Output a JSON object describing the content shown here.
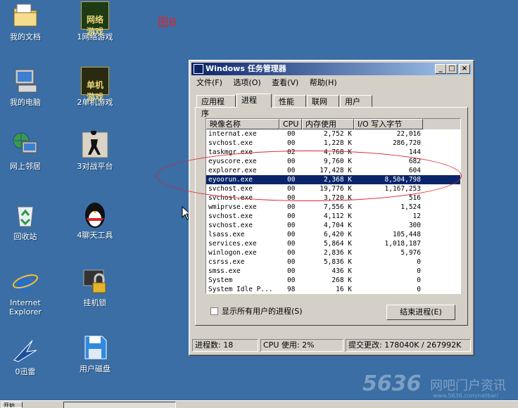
{
  "figure_label": "图B",
  "desktop": {
    "icons": [
      {
        "label": "我的文档"
      },
      {
        "label": "我的电脑"
      },
      {
        "label": "网上邻居"
      },
      {
        "label": "回收站"
      },
      {
        "label": "Internet\nExplorer"
      },
      {
        "label": "0迅雷"
      },
      {
        "label": "1网络游戏"
      },
      {
        "label": "2单机游戏"
      },
      {
        "label": "3对战平台"
      },
      {
        "label": "4聊天工具"
      },
      {
        "label": "挂机锁"
      },
      {
        "label": "用户磁盘"
      }
    ],
    "icon_art": {
      "net_game": "网络\n游戏",
      "single_game": "单机\n游戏"
    }
  },
  "window": {
    "title": "Windows 任务管理器",
    "controls": {
      "minimize": "_",
      "maximize": "□",
      "close": "×"
    },
    "menu": [
      "文件(F)",
      "选项(O)",
      "查看(V)",
      "帮助(H)"
    ],
    "tabs": [
      "应用程序",
      "进程",
      "性能",
      "联网",
      "用户"
    ],
    "active_tab": "进程",
    "columns": [
      "映像名称",
      "CPU",
      "内存使用",
      "I/O 写入字节"
    ],
    "processes": [
      [
        "internat.exe",
        "00",
        "2,752 K",
        "22,016"
      ],
      [
        "svchost.exe",
        "00",
        "1,228 K",
        "286,720"
      ],
      [
        "taskmgr.exe",
        "02",
        "4,768 K",
        "144"
      ],
      [
        "eyuscore.exe",
        "00",
        "9,760 K",
        "682"
      ],
      [
        "explorer.exe",
        "00",
        "17,428 K",
        "604"
      ],
      [
        "eyoorun.exe",
        "00",
        "2,368 K",
        "8,504,798"
      ],
      [
        "svchost.exe",
        "00",
        "19,776 K",
        "1,167,253"
      ],
      [
        "svchost.exe",
        "00",
        "3,720 K",
        "516"
      ],
      [
        "wmiprvse.exe",
        "00",
        "7,556 K",
        "1,524"
      ],
      [
        "svchost.exe",
        "00",
        "4,112 K",
        "12"
      ],
      [
        "svchost.exe",
        "00",
        "4,704 K",
        "300"
      ],
      [
        "lsass.exe",
        "00",
        "6,420 K",
        "105,448"
      ],
      [
        "services.exe",
        "00",
        "5,864 K",
        "1,018,187"
      ],
      [
        "winlogon.exe",
        "00",
        "2,836 K",
        "5,976"
      ],
      [
        "csrss.exe",
        "00",
        "5,836 K",
        "0"
      ],
      [
        "smss.exe",
        "00",
        "436 K",
        "0"
      ],
      [
        "System",
        "00",
        "268 K",
        "0"
      ],
      [
        "System Idle P...",
        "98",
        "16 K",
        "0"
      ]
    ],
    "selected_process": "eyoorun.exe",
    "show_all_users_label": "显示所有用户的进程(S)",
    "end_process_label": "结束进程(E)",
    "status": {
      "processes": "进程数: 18",
      "cpu": "CPU 使用: 2%",
      "commit": "提交更改: 178040K / 267992K"
    }
  },
  "taskbar": {
    "start_label": "开始"
  },
  "watermark": {
    "number": "5636",
    "text": "网吧门户资讯",
    "url": "www.5636.com/netbar/"
  },
  "colors": {
    "desktop": "#3a6ea5",
    "title_active": "#0a246a",
    "selection": "#0a246a",
    "annotation": "#d8262e"
  }
}
